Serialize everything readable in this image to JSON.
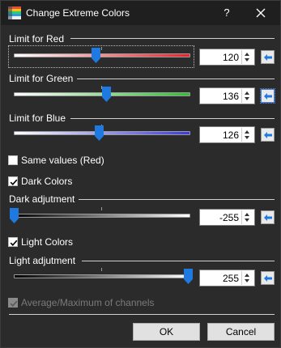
{
  "window": {
    "title": "Change Extreme Colors",
    "help_label": "?"
  },
  "colors": {
    "red": "#e8202a",
    "green": "#2fbf2f",
    "blue": "#3a3ae0",
    "handle": "#1e7ae0"
  },
  "sections": {
    "red": {
      "label": "Limit for Red",
      "value": "120",
      "slider_fraction": 0.47
    },
    "green": {
      "label": "Limit for Green",
      "value": "136",
      "slider_fraction": 0.53
    },
    "blue": {
      "label": "Limit for Blue",
      "value": "126",
      "slider_fraction": 0.49
    },
    "dark": {
      "label": "Dark adjutment",
      "value": "-255",
      "slider_fraction": 0.0
    },
    "light": {
      "label": "Light adjutment",
      "value": "255",
      "slider_fraction": 1.0
    }
  },
  "checkboxes": {
    "same_values": {
      "label": "Same values (Red)",
      "checked": false
    },
    "dark_colors": {
      "label": "Dark Colors",
      "checked": true
    },
    "light_colors": {
      "label": "Light Colors",
      "checked": true
    },
    "average": {
      "label": "Average/Maximum of channels",
      "checked": true,
      "disabled": true
    }
  },
  "buttons": {
    "ok": "OK",
    "cancel": "Cancel"
  },
  "icons": {
    "app": "palette-icon",
    "close": "close-icon",
    "copy": "copy-value-arrow-icon",
    "check": "check-icon",
    "spin_up": "chevron-up-icon",
    "spin_down": "chevron-down-icon"
  }
}
